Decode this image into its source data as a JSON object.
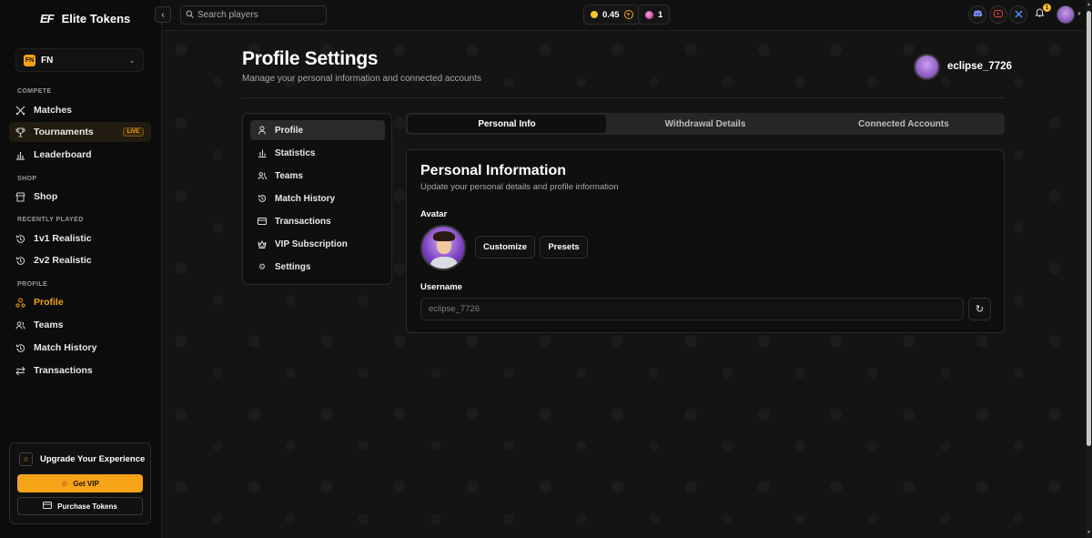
{
  "brand": {
    "logo": "EF",
    "name": "Elite Tokens"
  },
  "game_select": {
    "badge": "FN",
    "value": "FN"
  },
  "sidebar": {
    "sections": {
      "compete": "COMPETE",
      "shop": "SHOP",
      "recently_played": "RECENTLY PLAYED",
      "profile": "PROFILE"
    },
    "items": [
      {
        "label": "Matches",
        "icon": "swords-icon"
      },
      {
        "label": "Tournaments",
        "icon": "trophy-icon",
        "badge": "LIVE"
      },
      {
        "label": "Leaderboard",
        "icon": "bar-chart-icon"
      },
      {
        "label": "Shop",
        "icon": "shop-icon"
      },
      {
        "label": "1v1 Realistic",
        "icon": "history-icon"
      },
      {
        "label": "2v2 Realistic",
        "icon": "history-icon"
      },
      {
        "label": "Profile",
        "icon": "profile-icon"
      },
      {
        "label": "Teams",
        "icon": "users-icon"
      },
      {
        "label": "Match History",
        "icon": "history-icon"
      },
      {
        "label": "Transactions",
        "icon": "transfer-icon"
      }
    ]
  },
  "upgrade": {
    "title": "Upgrade Your Experience",
    "vip_label": "Get VIP",
    "tokens_label": "Purchase Tokens"
  },
  "topbar": {
    "search_placeholder": "Search players",
    "balance": "0.45",
    "gems": "1",
    "notifications": "1"
  },
  "colors": {
    "accent": "#f6a317",
    "background": "#141414",
    "panel": "#0f0f0f"
  },
  "header": {
    "title": "Profile Settings",
    "subtitle": "Manage your personal information and connected accounts",
    "username": "eclipse_7726"
  },
  "settings_menu": [
    {
      "label": "Profile",
      "icon": "user-icon"
    },
    {
      "label": "Statistics",
      "icon": "bar-chart-icon"
    },
    {
      "label": "Teams",
      "icon": "users-icon"
    },
    {
      "label": "Match History",
      "icon": "history-icon"
    },
    {
      "label": "Transactions",
      "icon": "card-icon"
    },
    {
      "label": "VIP Subscription",
      "icon": "crown-icon"
    },
    {
      "label": "Settings",
      "icon": "gear-icon"
    }
  ],
  "tabs": [
    "Personal Info",
    "Withdrawal Details",
    "Connected Accounts"
  ],
  "personal_info": {
    "title": "Personal Information",
    "subtitle": "Update your personal details and profile information",
    "avatar_label": "Avatar",
    "customize_label": "Customize",
    "presets_label": "Presets",
    "username_label": "Username",
    "username_value": "eclipse_7726"
  }
}
